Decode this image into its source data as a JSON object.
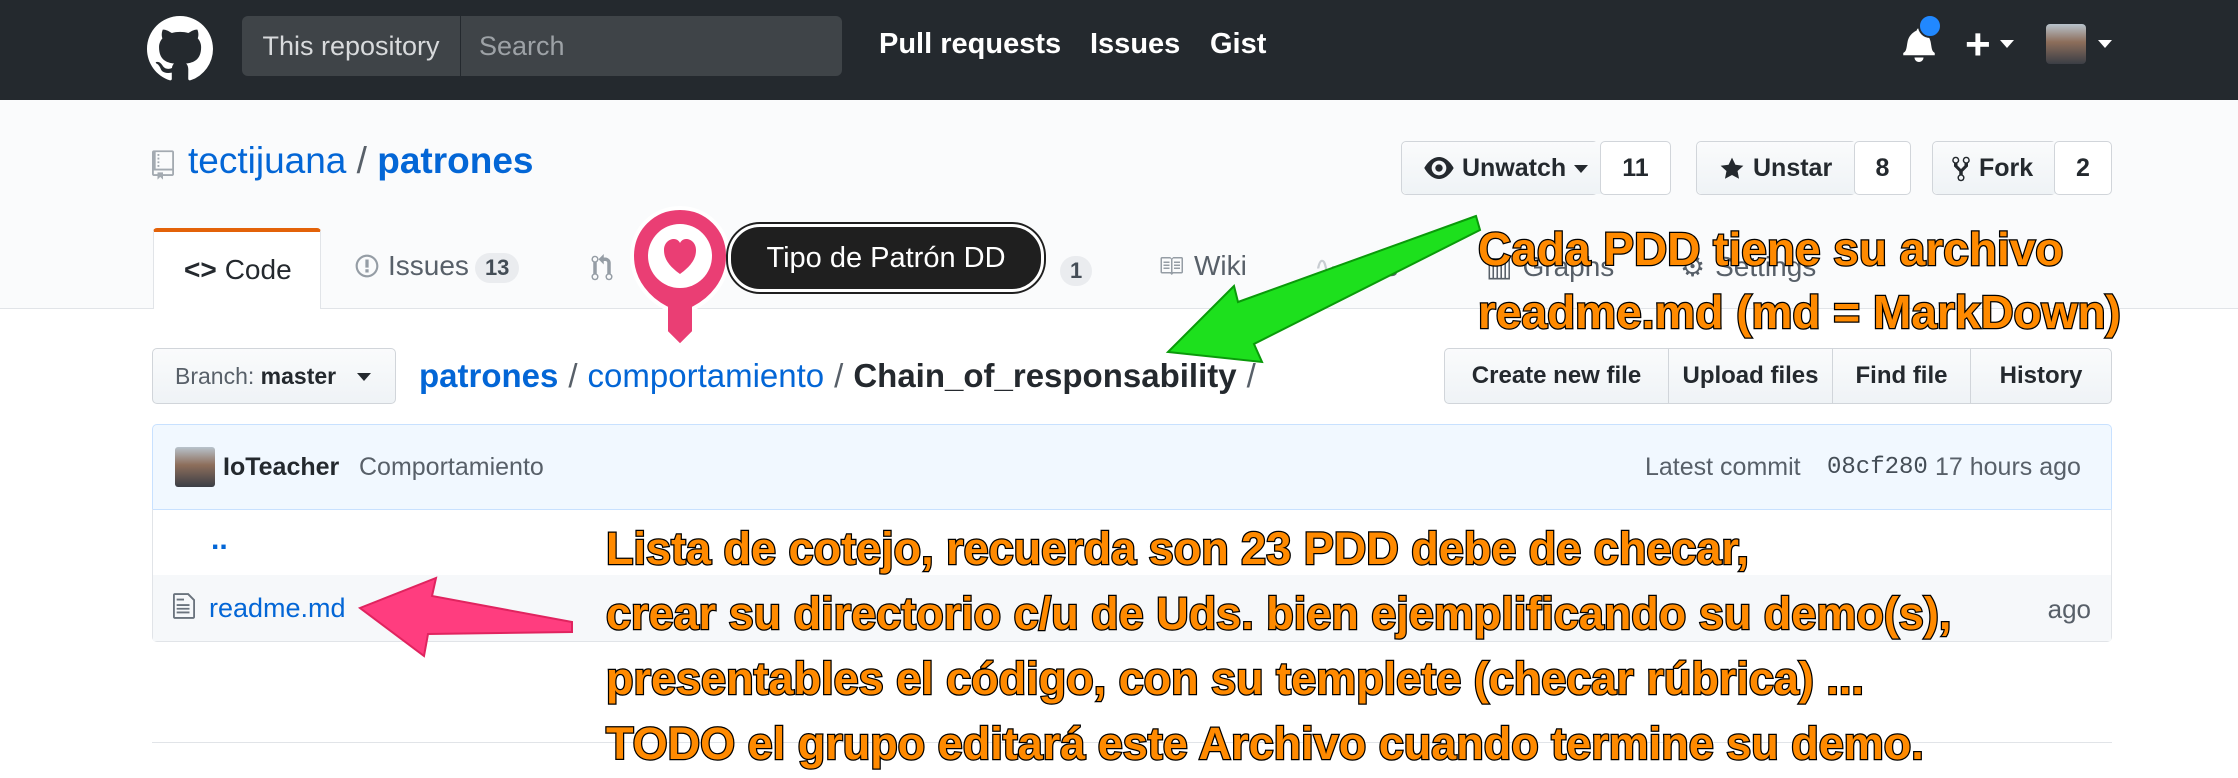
{
  "header": {
    "search_scope": "This repository",
    "search_placeholder": "Search",
    "nav": [
      "Pull requests",
      "Issues",
      "Gist"
    ],
    "notification_dot_color": "#2188ff"
  },
  "repo": {
    "owner": "tectijuana",
    "separator": "/",
    "name": "patrones",
    "actions": {
      "watch": {
        "label": "Unwatch",
        "count": "11"
      },
      "star": {
        "label": "Unstar",
        "count": "8"
      },
      "fork": {
        "label": "Fork",
        "count": "2"
      }
    },
    "tabs": {
      "code": "Code",
      "issues": {
        "label": "Issues",
        "count": "13"
      },
      "projects_count": "1",
      "wiki": "Wiki",
      "pulse": "ulse",
      "graphs": "Graphs",
      "settings": "Settings"
    }
  },
  "file_nav": {
    "branch_label": "Branch:",
    "branch_value": "master",
    "breadcrumb": {
      "root": "patrones",
      "folder": "comportamiento",
      "current": "Chain_of_responsability",
      "sep": "/"
    },
    "buttons": [
      "Create new file",
      "Upload files",
      "Find file",
      "History"
    ]
  },
  "commit": {
    "author": "IoTeacher",
    "message": "Comportamiento",
    "latest_label": "Latest commit",
    "sha": "08cf280",
    "time": "17 hours ago"
  },
  "files": {
    "parent": "..",
    "rows": [
      {
        "name": "readme.md",
        "age": "ago"
      }
    ]
  },
  "annotations": {
    "tooltip": "Tipo de Patrón DD",
    "note_top": [
      "Cada PDD tiene su archivo",
      "readme.md (md = MarkDown)"
    ],
    "note_bottom": [
      "Lista de cotejo, recuerda son 23 PDD debe de checar,",
      "crear su directorio c/u de Uds. bien ejemplificando su demo(s),",
      "presentables el código, con su templete (checar rúbrica) ...",
      "TODO el grupo editará este Archivo cuando termine su demo."
    ],
    "note_color": "#ff8a00",
    "green_arrow_color": "#1de01d",
    "pink_arrow_color": "#ff3d7f"
  }
}
